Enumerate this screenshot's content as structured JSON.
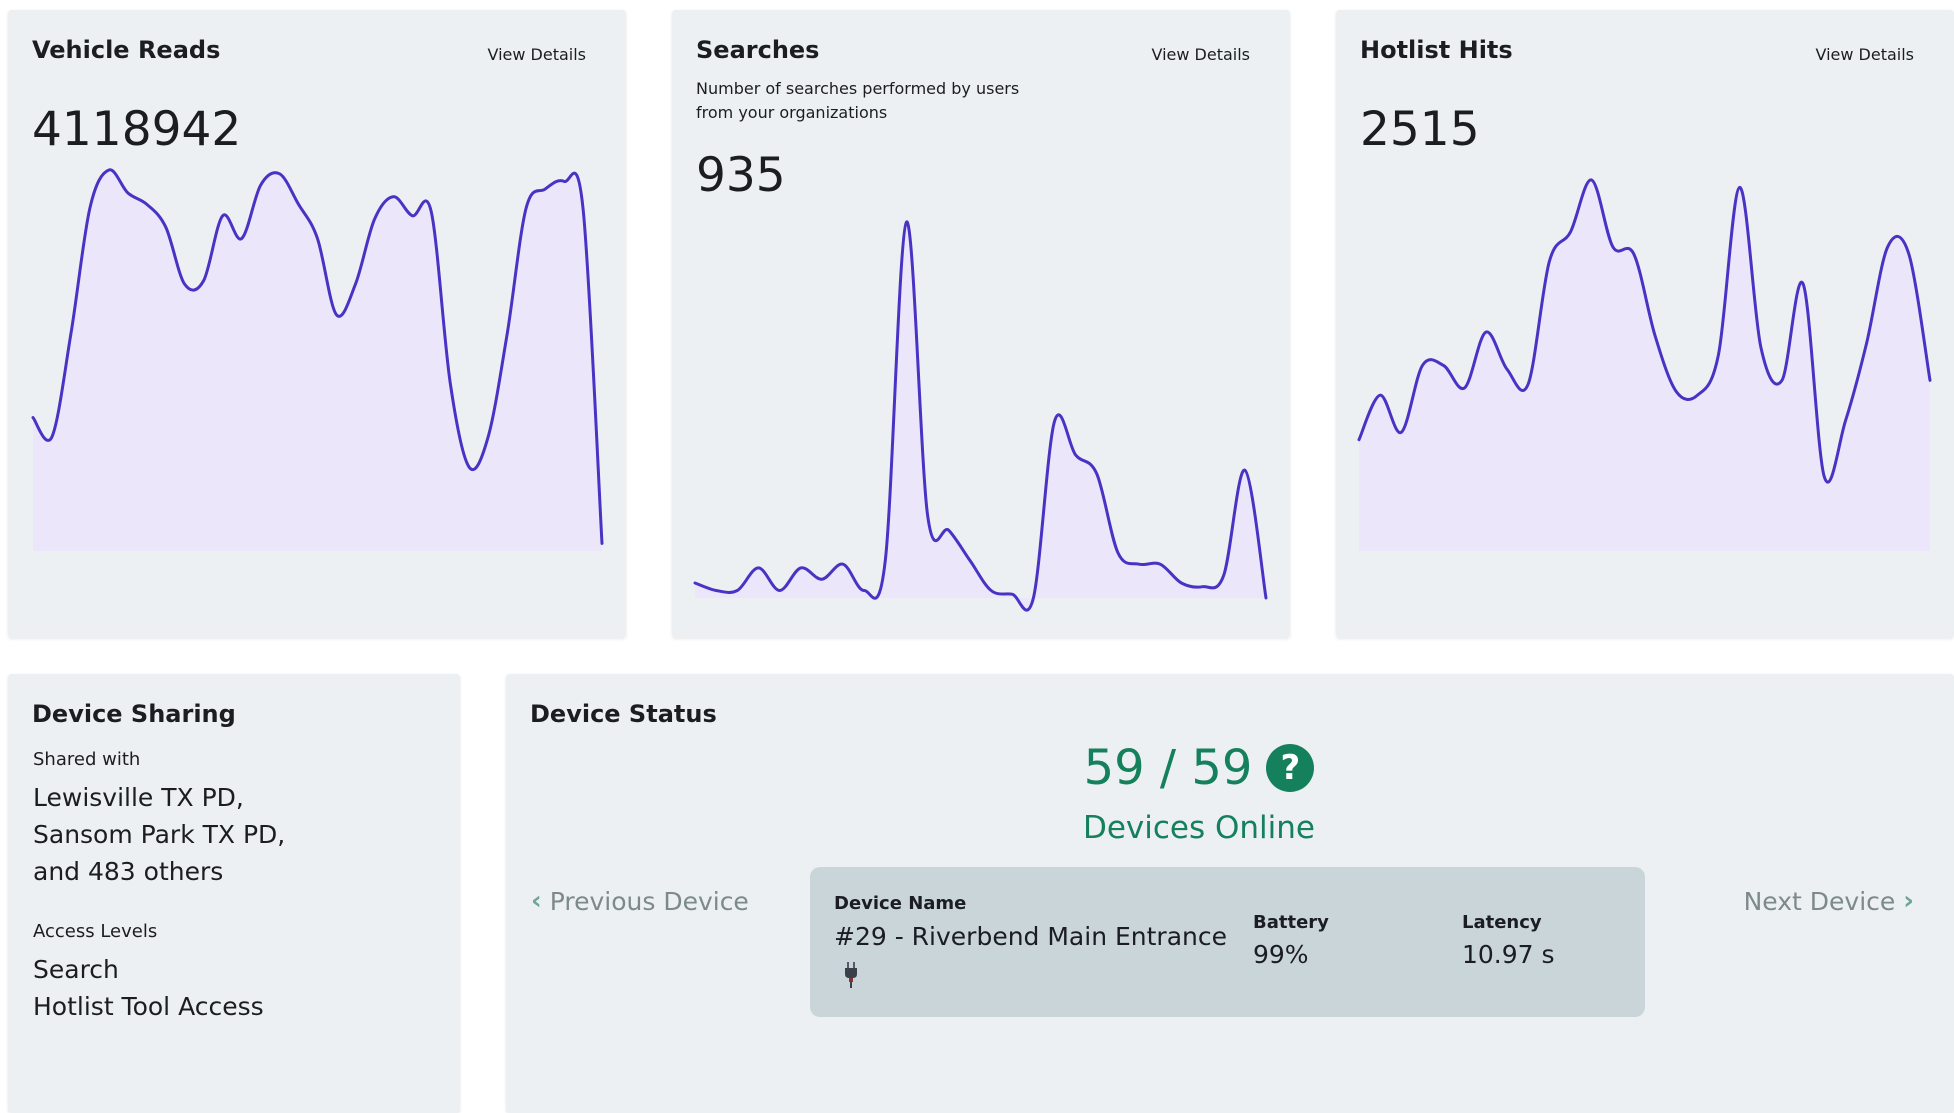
{
  "accent_color": "#4933c4",
  "fill_color": "#ebe6fa",
  "status_color": "#15805c",
  "cards": {
    "vehicle_reads": {
      "title": "Vehicle Reads",
      "view_details": "View Details",
      "value": "4118942"
    },
    "searches": {
      "title": "Searches",
      "view_details": "View Details",
      "description": "Number of searches performed by users from your organizations",
      "value": "935"
    },
    "hotlist_hits": {
      "title": "Hotlist Hits",
      "view_details": "View Details",
      "value": "2515"
    }
  },
  "chart_data": [
    {
      "type": "area",
      "title": "Vehicle Reads",
      "values": [
        0.35,
        0.3,
        0.57,
        0.9,
        1.0,
        0.94,
        0.91,
        0.85,
        0.7,
        0.71,
        0.88,
        0.82,
        0.96,
        0.99,
        0.91,
        0.82,
        0.62,
        0.7,
        0.87,
        0.93,
        0.88,
        0.89,
        0.44,
        0.22,
        0.3,
        0.57,
        0.9,
        0.95,
        0.97,
        0.9,
        0.02
      ]
    },
    {
      "type": "area",
      "title": "Searches",
      "values": [
        0.04,
        0.02,
        0.02,
        0.08,
        0.02,
        0.08,
        0.05,
        0.09,
        0.02,
        0.1,
        1.0,
        0.22,
        0.18,
        0.1,
        0.02,
        0.01,
        0.0,
        0.47,
        0.38,
        0.33,
        0.12,
        0.09,
        0.09,
        0.04,
        0.03,
        0.06,
        0.34,
        0.0
      ]
    },
    {
      "type": "area",
      "title": "Hotlist Hits",
      "values": [
        0.3,
        0.42,
        0.32,
        0.5,
        0.5,
        0.44,
        0.59,
        0.49,
        0.45,
        0.78,
        0.86,
        1.0,
        0.82,
        0.8,
        0.58,
        0.43,
        0.42,
        0.53,
        0.98,
        0.55,
        0.46,
        0.72,
        0.2,
        0.35,
        0.56,
        0.82,
        0.8,
        0.46
      ]
    }
  ],
  "device_sharing": {
    "title": "Device Sharing",
    "shared_label": "Shared with",
    "shared_lines": [
      "Lewisville TX PD,",
      "Sansom Park TX PD,",
      "and 483 others"
    ],
    "access_label": "Access Levels",
    "access_lines": [
      "Search",
      "Hotlist Tool Access"
    ]
  },
  "device_status": {
    "title": "Device Status",
    "count": "59 / 59",
    "help_icon": "question-circle-icon",
    "help_glyph": "?",
    "status_label": "Devices Online",
    "prev_label": "Previous Device",
    "next_label": "Next Device",
    "prev_glyph": "‹",
    "next_glyph": "›",
    "device": {
      "name_label": "Device Name",
      "name": "#29 - Riverbend Main Entrance",
      "power_icon": "plug-icon",
      "battery_label": "Battery",
      "battery": "99%",
      "latency_label": "Latency",
      "latency": "10.97 s"
    }
  }
}
